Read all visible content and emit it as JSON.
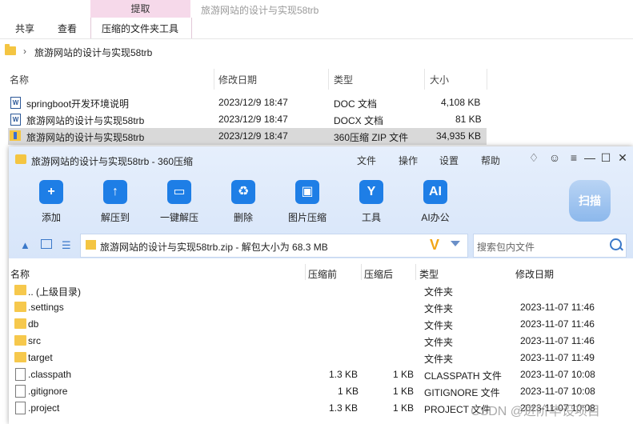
{
  "ribbon": {
    "context_tab_header": "提取",
    "window_title": "旅游网站的设计与实现58trb",
    "tabs": [
      "共享",
      "查看",
      "压缩的文件夹工具"
    ]
  },
  "address": {
    "path": "旅游网站的设计与实现58trb"
  },
  "explorer": {
    "columns": [
      "名称",
      "修改日期",
      "类型",
      "大小"
    ],
    "rows": [
      {
        "name": "springboot开发环境说明",
        "date": "2023/12/9 18:47",
        "type": "DOC 文档",
        "size": "4,108 KB",
        "icon": "word-doc-icon"
      },
      {
        "name": "旅游网站的设计与实现58trb",
        "date": "2023/12/9 18:47",
        "type": "DOCX 文档",
        "size": "81 KB",
        "icon": "word-docx-icon"
      },
      {
        "name": "旅游网站的设计与实现58trb",
        "date": "2023/12/9 18:47",
        "type": "360压缩 ZIP 文件",
        "size": "34,935 KB",
        "icon": "zip-archive-icon"
      }
    ]
  },
  "zip_window": {
    "title": "旅游网站的设计与实现58trb - 360压缩",
    "menu": [
      "文件",
      "操作",
      "设置",
      "帮助"
    ],
    "tools": [
      {
        "label": "添加",
        "glyph": "+"
      },
      {
        "label": "解压到",
        "glyph": "↑"
      },
      {
        "label": "一键解压",
        "glyph": "▭"
      },
      {
        "label": "删除",
        "glyph": "♻"
      },
      {
        "label": "图片压缩",
        "glyph": "▣"
      },
      {
        "label": "工具",
        "glyph": "Y"
      },
      {
        "label": "AI办公",
        "glyph": "AI"
      }
    ],
    "scan_label": "扫描",
    "path_text": "旅游网站的设计与实现58trb.zip - 解包大小为 68.3 MB",
    "path_badge": "V",
    "search_placeholder": "搜索包内文件",
    "columns": [
      "名称",
      "压缩前",
      "压缩后",
      "类型",
      "修改日期"
    ],
    "rows": [
      {
        "name": ".. (上级目录)",
        "before": "",
        "after": "",
        "type": "文件夹",
        "date": "",
        "kind": "folder"
      },
      {
        "name": ".settings",
        "before": "",
        "after": "",
        "type": "文件夹",
        "date": "2023-11-07 11:46",
        "kind": "folder"
      },
      {
        "name": "db",
        "before": "",
        "after": "",
        "type": "文件夹",
        "date": "2023-11-07 11:46",
        "kind": "folder"
      },
      {
        "name": "src",
        "before": "",
        "after": "",
        "type": "文件夹",
        "date": "2023-11-07 11:46",
        "kind": "folder"
      },
      {
        "name": "target",
        "before": "",
        "after": "",
        "type": "文件夹",
        "date": "2023-11-07 11:49",
        "kind": "folder"
      },
      {
        "name": ".classpath",
        "before": "1.3 KB",
        "after": "1 KB",
        "type": "CLASSPATH 文件",
        "date": "2023-11-07 10:08",
        "kind": "file"
      },
      {
        "name": ".gitignore",
        "before": "1 KB",
        "after": "1 KB",
        "type": "GITIGNORE 文件",
        "date": "2023-11-07 10:08",
        "kind": "file"
      },
      {
        "name": ".project",
        "before": "1.3 KB",
        "after": "1 KB",
        "type": "PROJECT 文件",
        "date": "2023-11-07 10:08",
        "kind": "file"
      }
    ]
  },
  "watermark": "CSDN @进阶毕设项目"
}
